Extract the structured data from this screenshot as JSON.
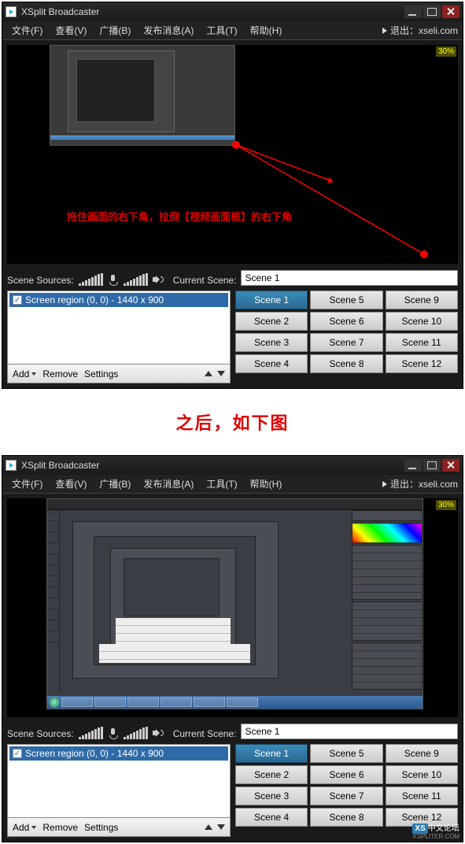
{
  "app": {
    "title": "XSplit Broadcaster"
  },
  "menu": {
    "file": "文件(F)",
    "view": "查看(V)",
    "broadcast": "广播(B)",
    "publish": "发布消息(A)",
    "tools": "工具(T)",
    "help": "帮助(H)",
    "exit_label": "退出：xseli.com"
  },
  "preview": {
    "percent": "30%",
    "instruction": "拖住画面的右下角，拉倒【视频画面框】的右下角"
  },
  "labels": {
    "sources": "Scene Sources:",
    "current_scene": "Current Scene:",
    "add": "Add",
    "remove": "Remove",
    "settings": "Settings"
  },
  "sources": {
    "items": [
      {
        "checked": true,
        "name": "Screen region (0, 0) - 1440 x 900"
      }
    ]
  },
  "scenes": {
    "current": "Scene 1",
    "active": "Scene 1",
    "grid": [
      "Scene 1",
      "Scene 5",
      "Scene 9",
      "Scene 2",
      "Scene 6",
      "Scene 10",
      "Scene 3",
      "Scene 7",
      "Scene 11",
      "Scene 4",
      "Scene 8",
      "Scene 12"
    ]
  },
  "divider": "之后，如下图",
  "watermark": {
    "badge": "XS",
    "text": "中文论坛",
    "sub": "XSPLITER.COM"
  }
}
